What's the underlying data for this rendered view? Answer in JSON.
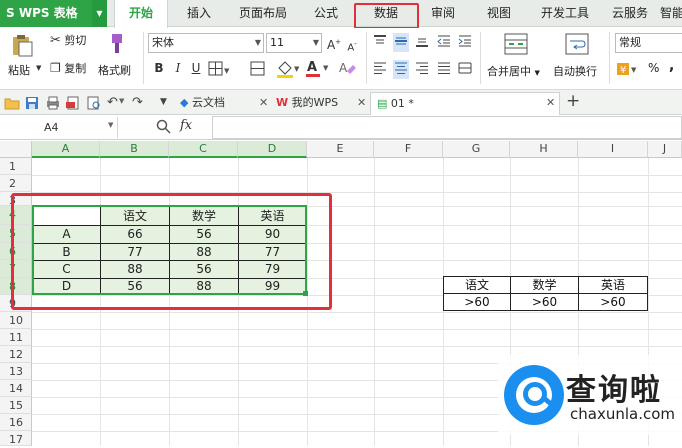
{
  "app": {
    "name": "WPS 表格"
  },
  "menu": {
    "tabs": [
      "开始",
      "插入",
      "页面布局",
      "公式",
      "数据",
      "审阅",
      "视图",
      "开发工具",
      "云服务",
      "智能"
    ],
    "active": "开始",
    "highlighted": "数据"
  },
  "ribbon": {
    "paste": "粘贴",
    "cut": "剪切",
    "copy": "复制",
    "format_painter": "格式刷",
    "font_name": "宋体",
    "font_size": "11",
    "bold": "B",
    "italic": "I",
    "underline": "U",
    "merge_center": "合并居中",
    "wrap_text": "自动换行",
    "number_format": "常规",
    "percent": "%",
    "comma": ","
  },
  "doc_tabs": [
    {
      "label": "云文档"
    },
    {
      "label": "我的WPS"
    },
    {
      "label": "01 *"
    }
  ],
  "formula_bar": {
    "cell_ref": "A4",
    "fx": "fx",
    "value": ""
  },
  "grid": {
    "columns": [
      "A",
      "B",
      "C",
      "D",
      "E",
      "F",
      "G",
      "H",
      "I",
      "J"
    ],
    "rows": [
      "1",
      "2",
      "3",
      "4",
      "5",
      "6",
      "7",
      "8",
      "9",
      "10",
      "11",
      "12",
      "13",
      "14",
      "15",
      "16",
      "17"
    ],
    "selected_columns": [
      "A",
      "B",
      "C",
      "D"
    ],
    "selected_rows": [
      "4",
      "5",
      "6",
      "7",
      "8"
    ]
  },
  "data_table": {
    "headers": [
      "",
      "语文",
      "数学",
      "英语"
    ],
    "rows": [
      [
        "A",
        "66",
        "56",
        "90"
      ],
      [
        "B",
        "77",
        "88",
        "77"
      ],
      [
        "C",
        "88",
        "56",
        "79"
      ],
      [
        "D",
        "56",
        "88",
        "99"
      ]
    ]
  },
  "criteria_table": {
    "headers": [
      "语文",
      "数学",
      "英语"
    ],
    "values": [
      ">60",
      ">60",
      ">60"
    ]
  },
  "colors": {
    "accent": "#2ea447",
    "highlight": "#e0303a",
    "selection_fill": "#e4f2df",
    "watermark": "#1b8ff0"
  },
  "watermark": {
    "title": "查询啦",
    "url": "chaxunla.com"
  }
}
